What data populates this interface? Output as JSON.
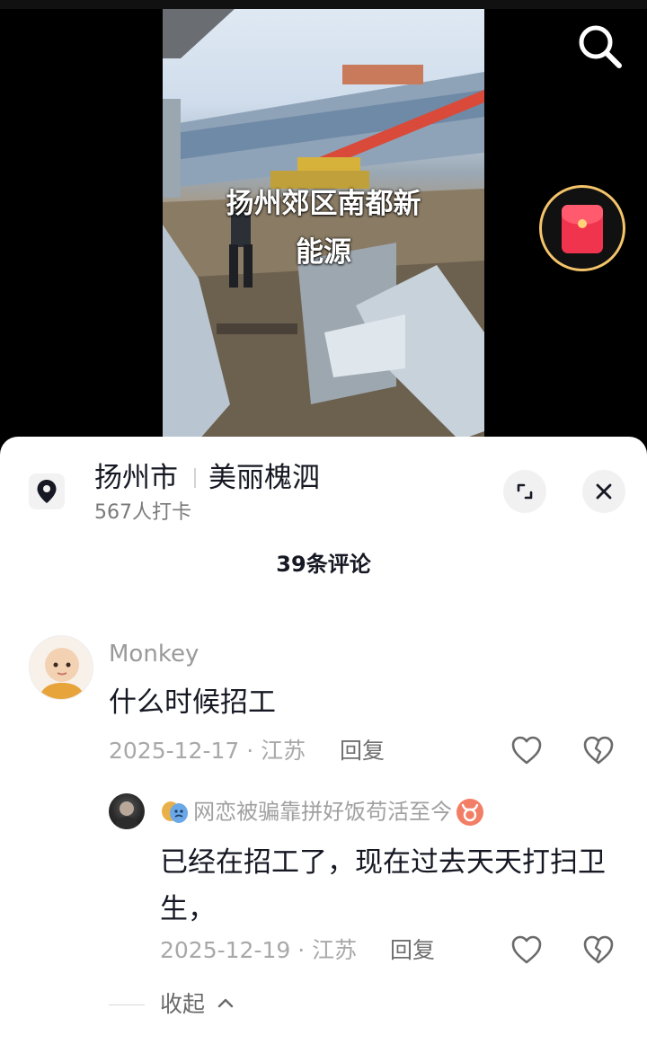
{
  "video": {
    "caption_line1": "扬州郊区南都新",
    "caption_line2": "能源"
  },
  "icons": {
    "search": "search-icon",
    "red_packet": "red-packet-icon",
    "location": "location-pin-icon",
    "expand": "expand-icon",
    "close": "close-icon",
    "like": "heart-icon",
    "dislike": "broken-heart-icon",
    "collapse": "chevron-up-icon"
  },
  "colors": {
    "red_packet": "#f0344e",
    "red_packet_ring": "#f4c46a",
    "text_primary": "#161823",
    "text_secondary": "#a8a8a8"
  },
  "location": {
    "city": "扬州市",
    "place": "美丽槐泗",
    "checkins": "567人打卡"
  },
  "comments_header": {
    "count_label": "39条评论"
  },
  "comments": [
    {
      "username": "Monkey",
      "text": "什么时候招工",
      "meta": "2025-12-17 · 江苏",
      "reply_label": "回复",
      "replies": [
        {
          "username": "网恋被骗靠拼好饭苟活至今",
          "text": "已经在招工了，现在过去天天打扫卫生，",
          "meta": "2025-12-19 · 江苏",
          "reply_label": "回复"
        }
      ]
    }
  ],
  "collapse_label": "收起"
}
